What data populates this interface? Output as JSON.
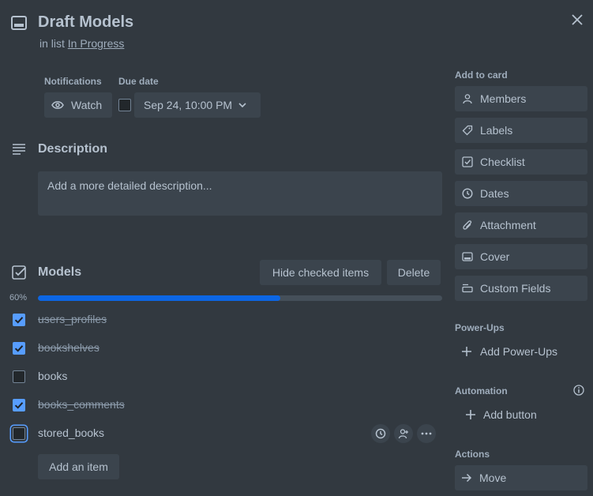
{
  "card": {
    "title": "Draft Models",
    "in_list_prefix": "in list ",
    "list_name": "In Progress"
  },
  "notifications": {
    "label": "Notifications",
    "watch_label": "Watch"
  },
  "due_date": {
    "label": "Due date",
    "value": "Sep 24, 10:00 PM",
    "checked": false
  },
  "description": {
    "title": "Description",
    "placeholder": "Add a more detailed description..."
  },
  "checklist": {
    "title": "Models",
    "hide_checked_label": "Hide checked items",
    "delete_label": "Delete",
    "progress_label": "60%",
    "progress_fraction": 0.6,
    "items": [
      {
        "label": "users_profiles",
        "checked": true
      },
      {
        "label": "bookshelves",
        "checked": true
      },
      {
        "label": "books",
        "checked": false
      },
      {
        "label": "books_comments",
        "checked": true
      },
      {
        "label": "stored_books",
        "checked": false
      }
    ],
    "add_item_label": "Add an item"
  },
  "sidebar": {
    "add_to_card_title": "Add to card",
    "add_to_card": [
      {
        "label": "Members",
        "icon": "person-icon"
      },
      {
        "label": "Labels",
        "icon": "tag-icon"
      },
      {
        "label": "Checklist",
        "icon": "checklist-icon"
      },
      {
        "label": "Dates",
        "icon": "clock-icon"
      },
      {
        "label": "Attachment",
        "icon": "paperclip-icon"
      },
      {
        "label": "Cover",
        "icon": "cover-icon"
      },
      {
        "label": "Custom Fields",
        "icon": "custom-fields-icon"
      }
    ],
    "power_ups_title": "Power-Ups",
    "add_power_ups_label": "Add Power-Ups",
    "automation_title": "Automation",
    "add_button_label": "Add button",
    "actions_title": "Actions",
    "move_label": "Move"
  },
  "colors": {
    "background": "#323940",
    "button": "#3b444d",
    "accent": "#579dff",
    "progress": "#0c66e4"
  }
}
